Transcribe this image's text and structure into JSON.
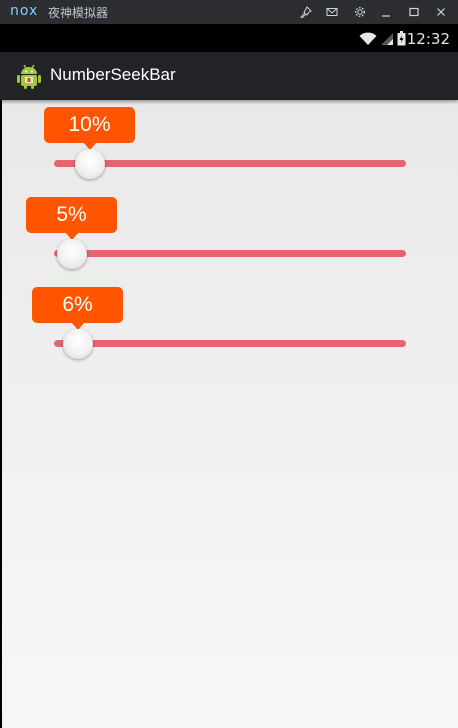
{
  "emulator": {
    "logo": "nox",
    "title": "夜神模拟器",
    "controls": [
      "pin-icon",
      "mail-icon",
      "settings-icon",
      "minimize-icon",
      "maximize-icon",
      "close-icon"
    ]
  },
  "status_bar": {
    "time": "12:32",
    "icons": [
      "wifi-icon",
      "signal-icon",
      "battery-icon"
    ]
  },
  "app_bar": {
    "title": "NumberSeekBar",
    "icon": "android-icon"
  },
  "seekbars": [
    {
      "label": "10%",
      "value": 10
    },
    {
      "label": "5%",
      "value": 5
    },
    {
      "label": "6%",
      "value": 6
    }
  ],
  "colors": {
    "bubble": "#ff5400",
    "track": "#e9636e",
    "action_bar": "#222326"
  }
}
